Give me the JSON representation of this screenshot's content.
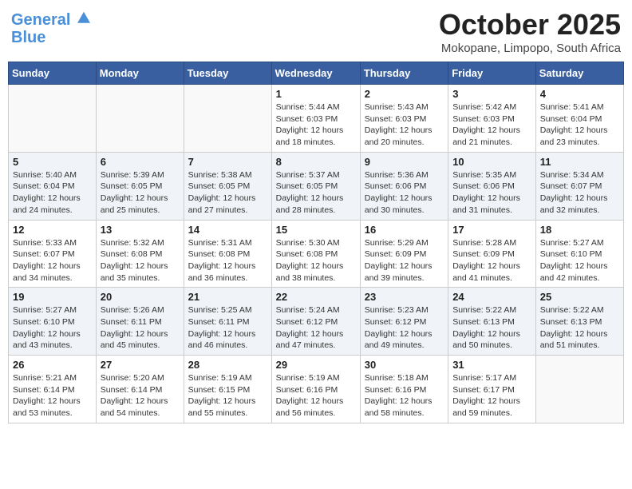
{
  "header": {
    "logo_line1": "General",
    "logo_line2": "Blue",
    "month": "October 2025",
    "location": "Mokopane, Limpopo, South Africa"
  },
  "days_of_week": [
    "Sunday",
    "Monday",
    "Tuesday",
    "Wednesday",
    "Thursday",
    "Friday",
    "Saturday"
  ],
  "weeks": [
    [
      {
        "day": "",
        "content": ""
      },
      {
        "day": "",
        "content": ""
      },
      {
        "day": "",
        "content": ""
      },
      {
        "day": "1",
        "content": "Sunrise: 5:44 AM\nSunset: 6:03 PM\nDaylight: 12 hours\nand 18 minutes."
      },
      {
        "day": "2",
        "content": "Sunrise: 5:43 AM\nSunset: 6:03 PM\nDaylight: 12 hours\nand 20 minutes."
      },
      {
        "day": "3",
        "content": "Sunrise: 5:42 AM\nSunset: 6:03 PM\nDaylight: 12 hours\nand 21 minutes."
      },
      {
        "day": "4",
        "content": "Sunrise: 5:41 AM\nSunset: 6:04 PM\nDaylight: 12 hours\nand 23 minutes."
      }
    ],
    [
      {
        "day": "5",
        "content": "Sunrise: 5:40 AM\nSunset: 6:04 PM\nDaylight: 12 hours\nand 24 minutes."
      },
      {
        "day": "6",
        "content": "Sunrise: 5:39 AM\nSunset: 6:05 PM\nDaylight: 12 hours\nand 25 minutes."
      },
      {
        "day": "7",
        "content": "Sunrise: 5:38 AM\nSunset: 6:05 PM\nDaylight: 12 hours\nand 27 minutes."
      },
      {
        "day": "8",
        "content": "Sunrise: 5:37 AM\nSunset: 6:05 PM\nDaylight: 12 hours\nand 28 minutes."
      },
      {
        "day": "9",
        "content": "Sunrise: 5:36 AM\nSunset: 6:06 PM\nDaylight: 12 hours\nand 30 minutes."
      },
      {
        "day": "10",
        "content": "Sunrise: 5:35 AM\nSunset: 6:06 PM\nDaylight: 12 hours\nand 31 minutes."
      },
      {
        "day": "11",
        "content": "Sunrise: 5:34 AM\nSunset: 6:07 PM\nDaylight: 12 hours\nand 32 minutes."
      }
    ],
    [
      {
        "day": "12",
        "content": "Sunrise: 5:33 AM\nSunset: 6:07 PM\nDaylight: 12 hours\nand 34 minutes."
      },
      {
        "day": "13",
        "content": "Sunrise: 5:32 AM\nSunset: 6:08 PM\nDaylight: 12 hours\nand 35 minutes."
      },
      {
        "day": "14",
        "content": "Sunrise: 5:31 AM\nSunset: 6:08 PM\nDaylight: 12 hours\nand 36 minutes."
      },
      {
        "day": "15",
        "content": "Sunrise: 5:30 AM\nSunset: 6:08 PM\nDaylight: 12 hours\nand 38 minutes."
      },
      {
        "day": "16",
        "content": "Sunrise: 5:29 AM\nSunset: 6:09 PM\nDaylight: 12 hours\nand 39 minutes."
      },
      {
        "day": "17",
        "content": "Sunrise: 5:28 AM\nSunset: 6:09 PM\nDaylight: 12 hours\nand 41 minutes."
      },
      {
        "day": "18",
        "content": "Sunrise: 5:27 AM\nSunset: 6:10 PM\nDaylight: 12 hours\nand 42 minutes."
      }
    ],
    [
      {
        "day": "19",
        "content": "Sunrise: 5:27 AM\nSunset: 6:10 PM\nDaylight: 12 hours\nand 43 minutes."
      },
      {
        "day": "20",
        "content": "Sunrise: 5:26 AM\nSunset: 6:11 PM\nDaylight: 12 hours\nand 45 minutes."
      },
      {
        "day": "21",
        "content": "Sunrise: 5:25 AM\nSunset: 6:11 PM\nDaylight: 12 hours\nand 46 minutes."
      },
      {
        "day": "22",
        "content": "Sunrise: 5:24 AM\nSunset: 6:12 PM\nDaylight: 12 hours\nand 47 minutes."
      },
      {
        "day": "23",
        "content": "Sunrise: 5:23 AM\nSunset: 6:12 PM\nDaylight: 12 hours\nand 49 minutes."
      },
      {
        "day": "24",
        "content": "Sunrise: 5:22 AM\nSunset: 6:13 PM\nDaylight: 12 hours\nand 50 minutes."
      },
      {
        "day": "25",
        "content": "Sunrise: 5:22 AM\nSunset: 6:13 PM\nDaylight: 12 hours\nand 51 minutes."
      }
    ],
    [
      {
        "day": "26",
        "content": "Sunrise: 5:21 AM\nSunset: 6:14 PM\nDaylight: 12 hours\nand 53 minutes."
      },
      {
        "day": "27",
        "content": "Sunrise: 5:20 AM\nSunset: 6:14 PM\nDaylight: 12 hours\nand 54 minutes."
      },
      {
        "day": "28",
        "content": "Sunrise: 5:19 AM\nSunset: 6:15 PM\nDaylight: 12 hours\nand 55 minutes."
      },
      {
        "day": "29",
        "content": "Sunrise: 5:19 AM\nSunset: 6:16 PM\nDaylight: 12 hours\nand 56 minutes."
      },
      {
        "day": "30",
        "content": "Sunrise: 5:18 AM\nSunset: 6:16 PM\nDaylight: 12 hours\nand 58 minutes."
      },
      {
        "day": "31",
        "content": "Sunrise: 5:17 AM\nSunset: 6:17 PM\nDaylight: 12 hours\nand 59 minutes."
      },
      {
        "day": "",
        "content": ""
      }
    ]
  ]
}
